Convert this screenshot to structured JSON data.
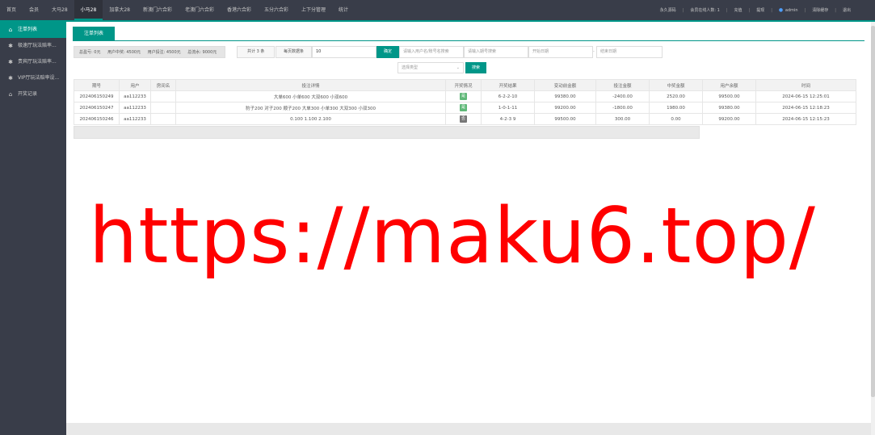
{
  "topnav": {
    "items": [
      "首页",
      "会员",
      "大马28",
      "小马28",
      "加拿大28",
      "新澳门六合彩",
      "老澳门六合彩",
      "香港六合彩",
      "五分六合彩",
      "上下分管理",
      "统计"
    ],
    "active_index": 3
  },
  "topright": {
    "permanent": "永久源码",
    "online": "会员在线人数: 1",
    "recharge": "充值",
    "withdraw": "提现",
    "user": "admin",
    "clear_cache": "清除缓存",
    "logout": "退出"
  },
  "sidebar": {
    "items": [
      {
        "label": "注单列表",
        "icon": "home-icon",
        "active": true
      },
      {
        "label": "极速厅玩法赔率...",
        "icon": "gear-icon",
        "active": false
      },
      {
        "label": "贵宾厅玩法赔率...",
        "icon": "gear-icon",
        "active": false
      },
      {
        "label": "VIP厅玩法赔率设...",
        "icon": "gear-icon",
        "active": false
      },
      {
        "label": "开奖记录",
        "icon": "home-icon",
        "active": false
      }
    ]
  },
  "tab": {
    "label": "注单列表"
  },
  "summary": {
    "total_bet": "总盈亏: 0元",
    "bet_amount": "用户中奖: 4500元",
    "user_balance": "用户投注: 4500元",
    "total_flow": "总流水: 9000元"
  },
  "filters": {
    "total": "共计 3 条",
    "pagesize_label": "每页数据条",
    "pagesize_value": "10",
    "confirm": "确定",
    "user_placeholder": "请输入用户名/账号名搜索",
    "order_placeholder": "请输入期号搜索",
    "start_placeholder": "开始日期",
    "dash": "-",
    "end_placeholder": "结束日期",
    "type_placeholder": "选择类型",
    "search": "搜索"
  },
  "table": {
    "headers": [
      "期号",
      "用户",
      "房间名",
      "投注详情",
      "开奖情况",
      "开奖结果",
      "变动前金额",
      "投注金额",
      "中奖金额",
      "用户余额",
      "时间"
    ],
    "rows": [
      {
        "issue": "202406150249",
        "user": "aa112233",
        "room": "",
        "detail": "大单600 小单600 大双600 小双600",
        "opened": true,
        "opened_text": "是",
        "result": "6-2-2-10",
        "before": "99380.00",
        "bet": "-2400.00",
        "win": "2520.00",
        "balance": "99500.00",
        "time": "2024-06-15 12:25:01"
      },
      {
        "issue": "202406150247",
        "user": "aa112233",
        "room": "",
        "detail": "豹子200 对子200 顺子200 大单300 小单300 大双300 小双300",
        "opened": true,
        "opened_text": "是",
        "result": "1-0-1-11",
        "before": "99200.00",
        "bet": "-1800.00",
        "win": "1980.00",
        "balance": "99380.00",
        "time": "2024-06-15 12:18:23"
      },
      {
        "issue": "202406150246",
        "user": "aa112233",
        "room": "",
        "detail": "0.100 1.100 2.100",
        "opened": false,
        "opened_text": "否",
        "result": "4-2-3 9",
        "before": "99500.00",
        "bet": "300.00",
        "win": "0.00",
        "balance": "99200.00",
        "time": "2024-06-15 12:15:23"
      }
    ]
  },
  "watermark": "https://maku6.top/",
  "colors": {
    "accent": "#009688",
    "topbar": "#393d49",
    "watermark": "#ff0000",
    "badge_yes": "#5fb878",
    "badge_no": "#777777"
  }
}
